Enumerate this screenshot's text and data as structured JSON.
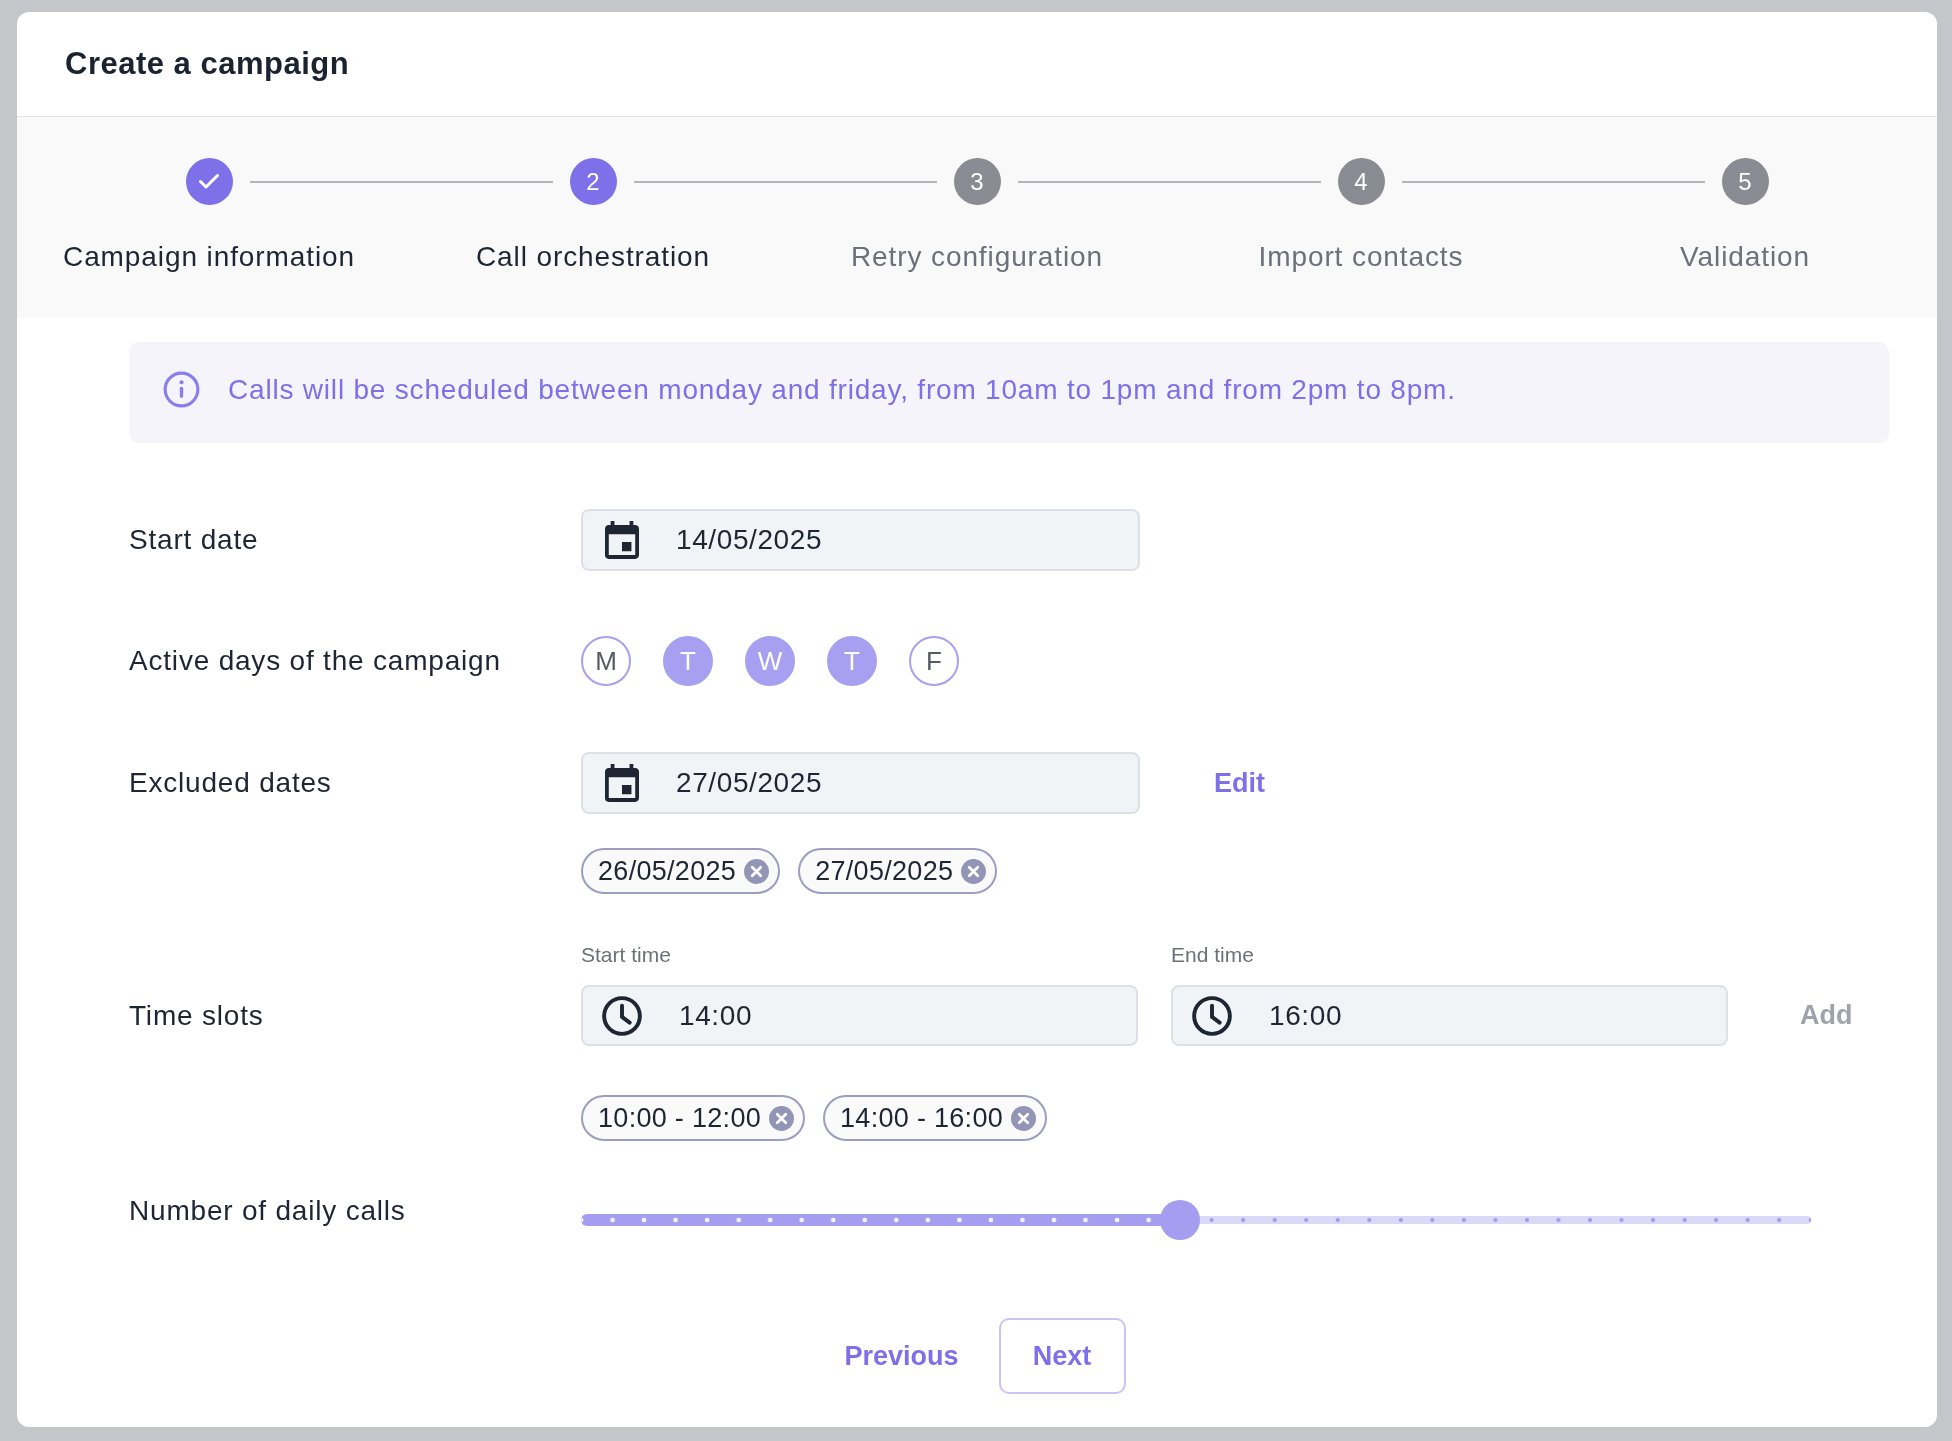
{
  "dialog": {
    "title": "Create a campaign"
  },
  "steps": [
    {
      "label": "Campaign information",
      "completed": true,
      "selected": false
    },
    {
      "label": "Call orchestration",
      "number": "2",
      "completed": false,
      "selected": true
    },
    {
      "label": "Retry configuration",
      "number": "3",
      "completed": false,
      "selected": false
    },
    {
      "label": "Import contacts",
      "number": "4",
      "completed": false,
      "selected": false
    },
    {
      "label": "Validation",
      "number": "5",
      "completed": false,
      "selected": false
    }
  ],
  "info_banner": {
    "text": "Calls will be scheduled between monday and friday, from 10am to 1pm and from 2pm to 8pm."
  },
  "start_date": {
    "label": "Start date",
    "value": "14/05/2025"
  },
  "active_days": {
    "label": "Active days of the campaign",
    "days": [
      {
        "letter": "M",
        "selected": false
      },
      {
        "letter": "T",
        "selected": true
      },
      {
        "letter": "W",
        "selected": true
      },
      {
        "letter": "T",
        "selected": true
      },
      {
        "letter": "F",
        "selected": false
      }
    ]
  },
  "excluded_dates": {
    "label": "Excluded dates",
    "value": "27/05/2025",
    "action": {
      "label": "Edit",
      "disabled": false
    },
    "chips": [
      {
        "label": "26/05/2025"
      },
      {
        "label": "27/05/2025"
      }
    ]
  },
  "time_slots": {
    "label": "Time slots",
    "start_time": {
      "label": "Start time",
      "value": "14:00"
    },
    "end_time": {
      "label": "End time",
      "value": "16:00"
    },
    "action": {
      "label": "Add",
      "disabled": true
    },
    "chips": [
      {
        "label": "10:00 - 12:00"
      },
      {
        "label": "14:00 - 16:00"
      }
    ]
  },
  "daily_calls": {
    "label": "Number of daily calls",
    "level": 0.487
  },
  "footer": {
    "buttons": [
      {
        "label": "Previous",
        "kind": "text"
      },
      {
        "label": "Next",
        "kind": "outlined"
      }
    ]
  }
}
